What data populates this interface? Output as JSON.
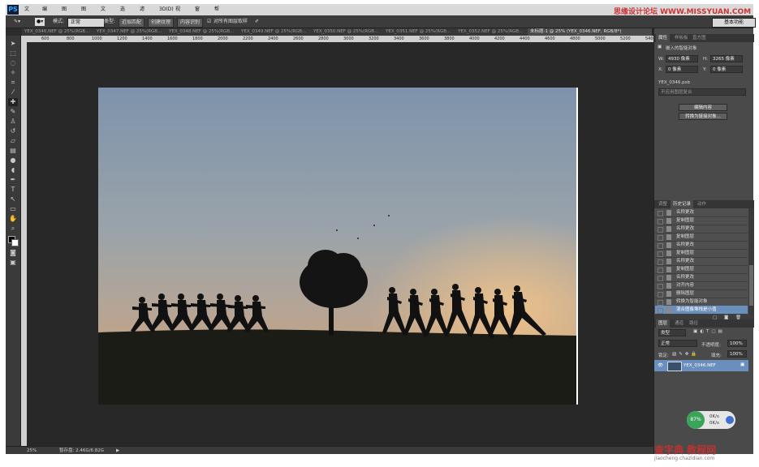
{
  "menubar": {
    "logo": "PS",
    "items": [
      "文件(F)",
      "编辑(E)",
      "图像(I)",
      "图层(L)",
      "文字(Y)",
      "选择(S)",
      "滤镜(T)",
      "3D(D)",
      "视图(V)",
      "窗口(W)",
      "帮助(H)"
    ],
    "watermark": "思缘设计论坛 WWW.MISSYUAN.COM"
  },
  "options": {
    "mode_label": "模式:",
    "mode_value": "正常",
    "type_label": "类型:",
    "type_options": [
      "近似匹配",
      "创建纹理",
      "内容识别"
    ],
    "sample_all": "对所有图层取样",
    "workspace": "基本功能"
  },
  "tabs": [
    "YEX_0346.NEF @ 25%(RGB...",
    "YEX_0347.NEF @ 25%(RGB...",
    "YEX_0348.NEF @ 25%(RGB...",
    "YEX_0349.NEF @ 25%(RGB...",
    "YEX_0350.NEF @ 25%(RGB...",
    "YEX_0351.NEF @ 25%(RGB...",
    "YEX_0352.NEF @ 25%(RGB...",
    "未标题-1 @ 25% (YEX_0346.NEF, RGB/8*)"
  ],
  "ruler": [
    "600",
    "800",
    "1000",
    "1200",
    "1400",
    "1600",
    "1800",
    "2000",
    "2200",
    "2400",
    "2600",
    "2800",
    "3000",
    "3200",
    "3400",
    "3600",
    "3800",
    "4000",
    "4200",
    "4400",
    "4600",
    "4800",
    "5000",
    "5200",
    "5400"
  ],
  "status": {
    "zoom": "25%",
    "scratch": "暂存盘: 2.46G/6.82G"
  },
  "properties": {
    "tabs": [
      "属性",
      "样板板",
      "直方图"
    ],
    "title": "嵌入的智能对象",
    "w_label": "W:",
    "w_value": "4930 像素",
    "h_label": "H:",
    "h_value": "3265 像素",
    "x_label": "X:",
    "x_value": "0 像素",
    "y_label": "Y:",
    "y_value": "0 像素",
    "file": "YEX_0346.psb",
    "comp_placeholder": "不应用图层复合",
    "edit_button": "编辑内容",
    "convert_button": "转换为链接对象..."
  },
  "history": {
    "tabs": [
      "调整",
      "历史记录",
      "动作"
    ],
    "rows": [
      "名称更改",
      "复制图层",
      "名称更改",
      "复制图层",
      "名称更改",
      "复制图层",
      "名称更改",
      "复制图层",
      "名称更改",
      "对齐内容",
      "删除图层",
      "转换为智能对象",
      "混合图像堆栈是小值"
    ],
    "active_index": 12
  },
  "layers": {
    "tabs": [
      "图层",
      "通道",
      "路径"
    ],
    "kind": "类型",
    "blend": "正常",
    "opacity_label": "不透明度:",
    "opacity": "100%",
    "lock_label": "锁定:",
    "fill_label": "填充:",
    "fill": "100%",
    "layer_name": "YEX_0346.NEF"
  },
  "widget": {
    "percent": "87%",
    "up": "0K/s",
    "down": "0K/s"
  },
  "watermark_bottom": "查字典 教程网",
  "watermark_bottom_sub": "jiaocheng.chazidian.com",
  "colors": {
    "accent": "#6b8fbd",
    "panel": "#4a4a4a",
    "canvas_bg": "#282828"
  }
}
